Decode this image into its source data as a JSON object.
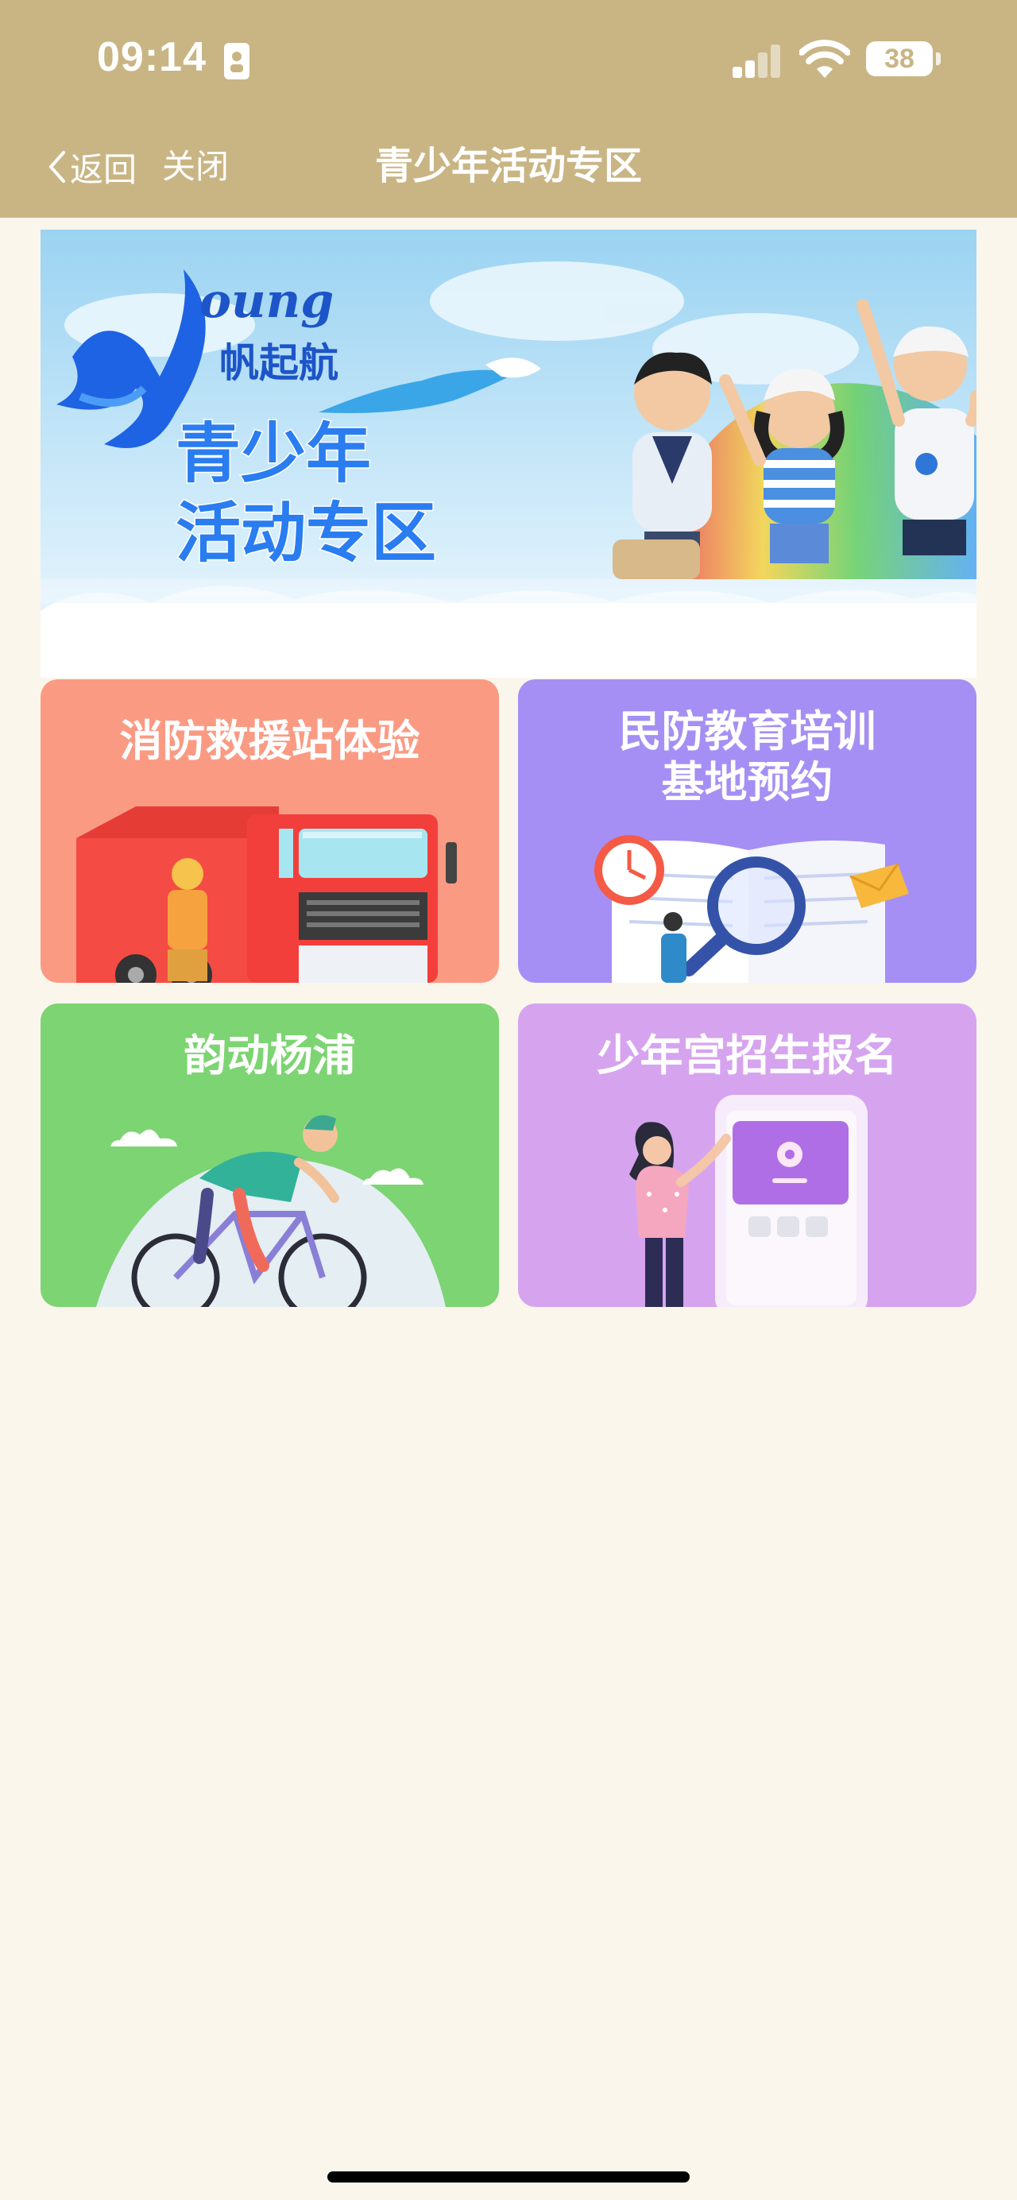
{
  "status_bar": {
    "time": "09:14",
    "battery": "38"
  },
  "nav": {
    "back_label": "返回",
    "close_label": "关闭",
    "title": "青少年活动专区"
  },
  "banner": {
    "logo_letters": "oung",
    "logo_subtitle": "帆起航",
    "headline_line1": "青少年",
    "headline_line2": "活动专区"
  },
  "cards": [
    {
      "label": "消防救援站体验",
      "color": "#fb9a83"
    },
    {
      "label": "民防教育培训\n基地预约",
      "color": "#a58ff4"
    },
    {
      "label": "韵动杨浦",
      "color": "#7dd472"
    },
    {
      "label": "少年宫招生报名",
      "color": "#d6a4ef"
    }
  ]
}
